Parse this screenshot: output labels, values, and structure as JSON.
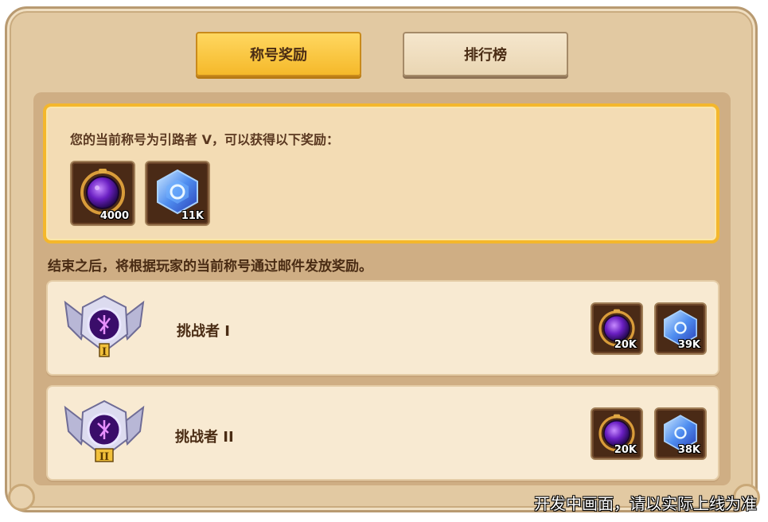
{
  "tabs": [
    {
      "label": "称号奖励",
      "active": true
    },
    {
      "label": "排行榜",
      "active": false
    }
  ],
  "current": {
    "text": "您的当前称号为引路者 V，可以获得以下奖励：",
    "rewards": [
      {
        "icon": "purple-orb-icon",
        "count": "4000"
      },
      {
        "icon": "blue-crystal-icon",
        "count": "11K"
      }
    ]
  },
  "note": "结束之后，将根据玩家的当前称号通过邮件发放奖励。",
  "ranks": [
    {
      "name": "挑战者 I",
      "numeral": "I",
      "rewards": [
        {
          "icon": "purple-orb-icon",
          "count": "20K"
        },
        {
          "icon": "blue-crystal-icon",
          "count": "39K"
        }
      ]
    },
    {
      "name": "挑战者 II",
      "numeral": "II",
      "rewards": [
        {
          "icon": "purple-orb-icon",
          "count": "20K"
        },
        {
          "icon": "blue-crystal-icon",
          "count": "38K"
        }
      ]
    }
  ],
  "watermark": "开发中画面，请以实际上线为准",
  "colors": {
    "accent": "#f4b72c",
    "panel": "#e2c9a2",
    "text": "#4a2c14"
  }
}
